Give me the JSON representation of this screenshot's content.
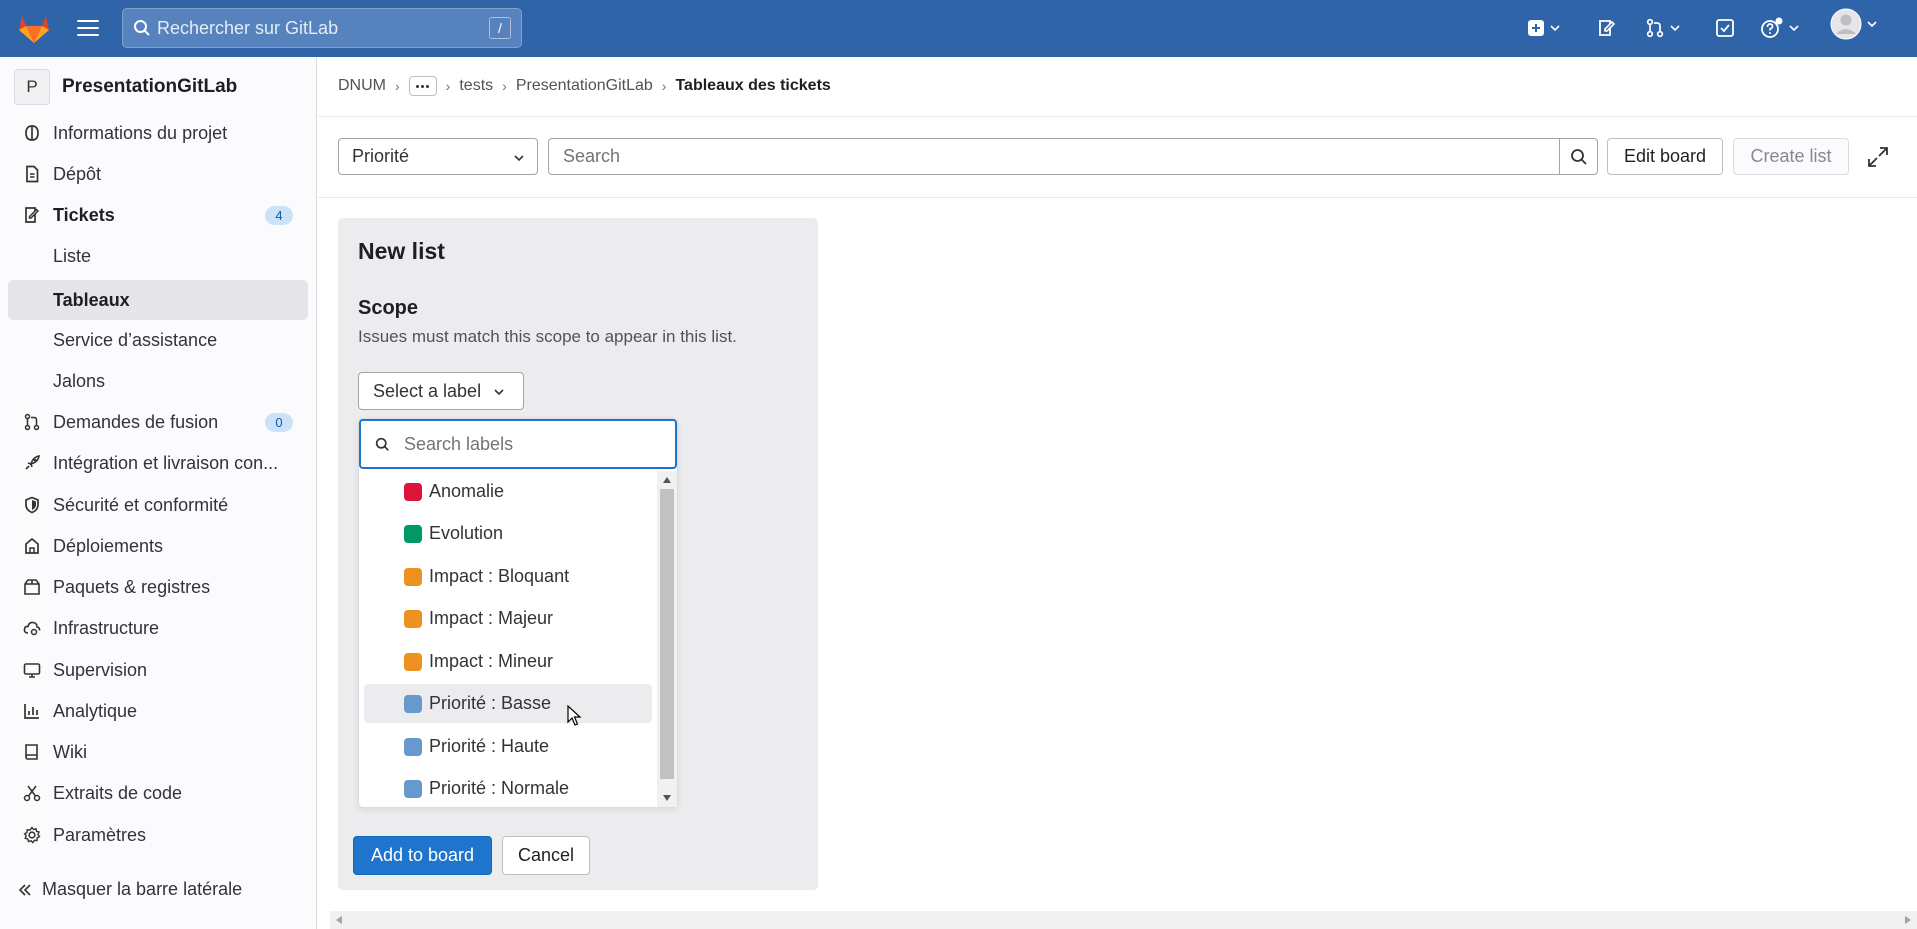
{
  "topbar": {
    "search_placeholder": "Rechercher sur GitLab",
    "search_shortcut": "/",
    "icons": [
      "tanuki-logo-icon",
      "hamburger-icon",
      "search-icon",
      "plus-square-icon",
      "issues-icon",
      "merge-request-icon",
      "todo-icon",
      "help-icon",
      "user-avatar-icon"
    ]
  },
  "sidebar": {
    "project_initial": "P",
    "project_name": "PresentationGitLab",
    "items": [
      {
        "label": "Informations du projet",
        "icon": "project-icon"
      },
      {
        "label": "Dépôt",
        "icon": "document-icon"
      },
      {
        "label": "Tickets",
        "icon": "issues-icon",
        "badge": "4"
      },
      {
        "label": "Liste"
      },
      {
        "label": "Tableaux"
      },
      {
        "label": "Service d’assistance"
      },
      {
        "label": "Jalons"
      },
      {
        "label": "Demandes de fusion",
        "icon": "merge-request-icon",
        "badge": "0"
      },
      {
        "label": "Intégration et livraison con...",
        "icon": "rocket-icon"
      },
      {
        "label": "Sécurité et conformité",
        "icon": "shield-icon"
      },
      {
        "label": "Déploiements",
        "icon": "deployments-icon"
      },
      {
        "label": "Paquets & registres",
        "icon": "package-icon"
      },
      {
        "label": "Infrastructure",
        "icon": "cloud-gear-icon"
      },
      {
        "label": "Supervision",
        "icon": "monitor-icon"
      },
      {
        "label": "Analytique",
        "icon": "chart-icon"
      },
      {
        "label": "Wiki",
        "icon": "book-icon"
      },
      {
        "label": "Extraits de code",
        "icon": "scissors-icon"
      },
      {
        "label": "Paramètres",
        "icon": "gear-icon"
      }
    ],
    "collapse_label": "Masquer la barre latérale"
  },
  "breadcrumb": {
    "items": [
      "DNUM",
      "tests",
      "PresentationGitLab"
    ],
    "current": "Tableaux des tickets"
  },
  "toolbar": {
    "board_select": "Priorité",
    "filter_placeholder": "Search",
    "edit_board": "Edit board",
    "create_list": "Create list"
  },
  "new_list": {
    "title": "New list",
    "scope_title": "Scope",
    "scope_help": "Issues must match this scope to appear in this list.",
    "select_label": "Select a label",
    "search_placeholder": "Search labels",
    "labels": [
      {
        "name": "Anomalie",
        "color": "#dc143c"
      },
      {
        "name": "Evolution",
        "color": "#009966"
      },
      {
        "name": "Impact : Bloquant",
        "color": "#ed9121"
      },
      {
        "name": "Impact : Majeur",
        "color": "#ed9121"
      },
      {
        "name": "Impact : Mineur",
        "color": "#ed9121"
      },
      {
        "name": "Priorité : Basse",
        "color": "#6699cc"
      },
      {
        "name": "Priorité : Haute",
        "color": "#6699cc"
      },
      {
        "name": "Priorité : Normale",
        "color": "#6699cc"
      }
    ],
    "add_button": "Add to board",
    "cancel_button": "Cancel"
  }
}
